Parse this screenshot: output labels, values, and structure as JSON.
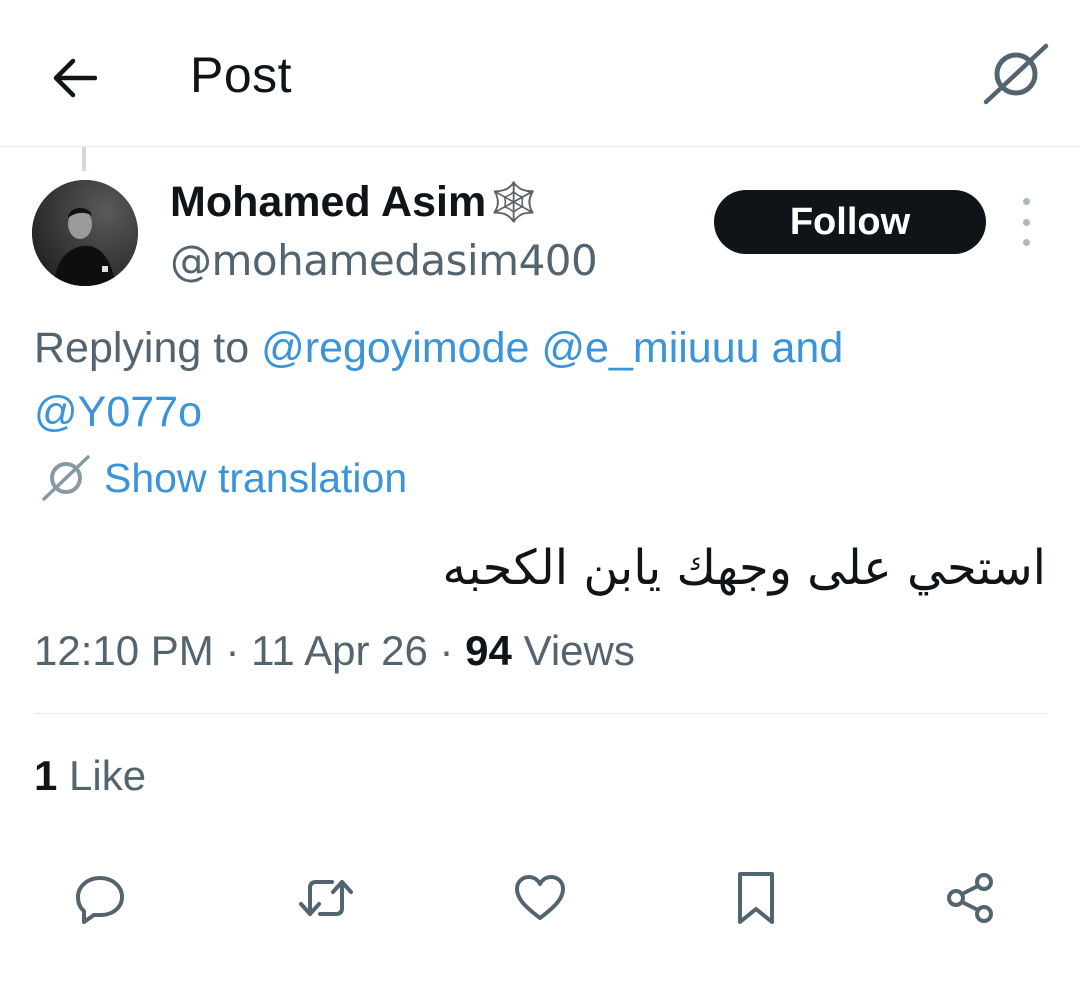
{
  "header": {
    "back_icon": "arrow-left-icon",
    "title": "Post",
    "translate_icon": "translate-icon"
  },
  "author": {
    "name": "Mohamed Asim",
    "name_decoration": "🕸️",
    "handle": "@mohamedasim400",
    "follow_label": "Follow",
    "more_icon": "more-vertical-icon"
  },
  "reply": {
    "prefix": "Replying to",
    "mentions": [
      "@regoyimode",
      "@e_miiuuu"
    ],
    "conjunction": "and",
    "last_mention": "@Y077o"
  },
  "translation": {
    "label": "Show translation",
    "icon": "translate-icon"
  },
  "post": {
    "text": "استحي على وجهك يابن الكحبه",
    "time": "12:10 PM",
    "separator": "·",
    "date": "11 Apr 26",
    "views_count": "94",
    "views_label": "Views"
  },
  "stats": {
    "likes_count": "1",
    "likes_label": "Like"
  },
  "actions": {
    "reply_icon": "reply-icon",
    "repost_icon": "repost-icon",
    "like_icon": "heart-icon",
    "bookmark_icon": "bookmark-icon",
    "share_icon": "share-icon"
  },
  "colors": {
    "text_primary": "#0f1419",
    "text_secondary": "#536471",
    "link": "#3b94d9",
    "divider": "#e6e9ec"
  }
}
